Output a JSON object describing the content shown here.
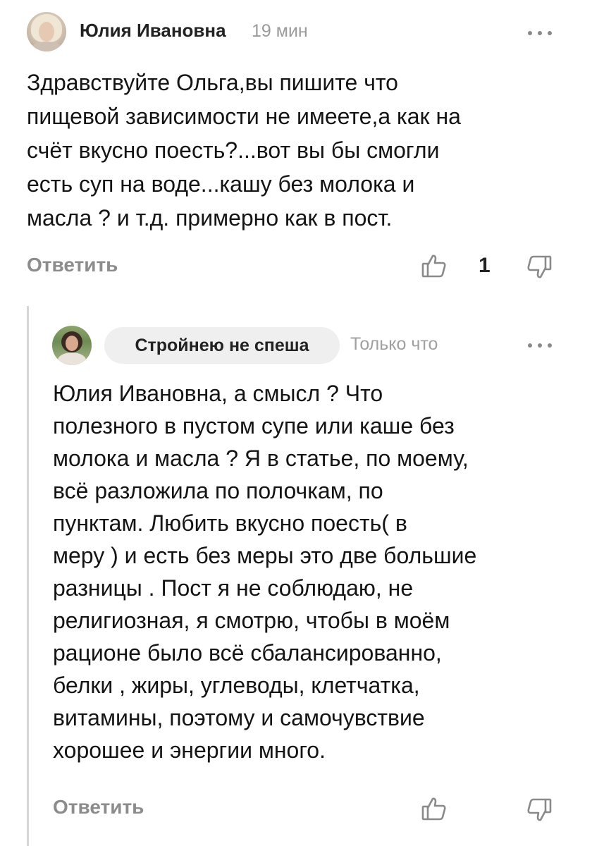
{
  "comment": {
    "author": "Юлия Ивановна",
    "time": "19 мин",
    "text": "Здравствуйте Ольга,вы пишите что\nпищевой зависимости не имеете,а как на\nсчёт вкусно поесть?...вот вы бы смогли\nесть суп на воде...кашу без молока и\nмасла ? и т.д.  примерно как в пост.",
    "reply_label": "Ответить",
    "likes": "1",
    "icons": {
      "more": "more-horizontal-icon",
      "like": "thumbs-up-icon",
      "dislike": "thumbs-down-icon"
    }
  },
  "reply": {
    "author": "Стройнею не спеша",
    "time": "Только что",
    "text": "Юлия Ивановна, а смысл ? Что\nполезного в пустом супе или каше без\nмолока и масла ? Я в статье, по моему,\nвсё разложила по полочкам, по\nпунктам. Любить вкусно поесть( в\nмеру ) и есть без меры это две большие\nразницы . Пост я не соблюдаю, не\nрелигиозная, я смотрю, чтобы в моём\nрационе было всё сбалансированно,\nбелки , жиры, углеводы, клетчатка,\nвитамины, поэтому и самочувствие\nхорошее и энергии много.",
    "reply_label": "Ответить",
    "icons": {
      "more": "more-horizontal-icon",
      "like": "thumbs-up-icon",
      "dislike": "thumbs-down-icon"
    }
  },
  "colors": {
    "muted_text": "#8c8c8c",
    "time_text": "#9a9a9a",
    "pill_background": "#efefef",
    "thread_line": "#d6d6d6"
  }
}
